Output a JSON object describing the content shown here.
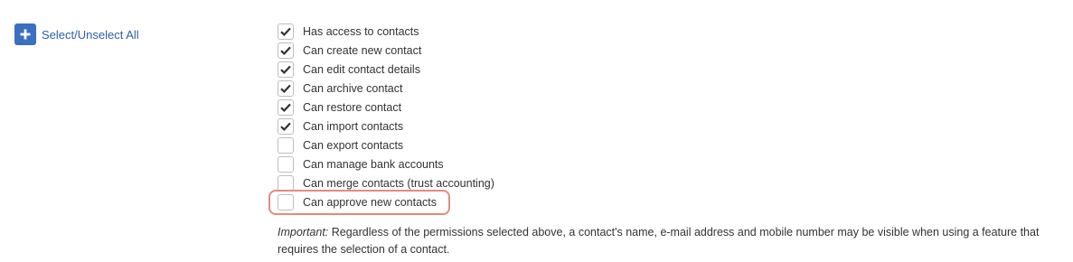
{
  "select_all": {
    "label": "Select/Unselect All",
    "icon": "plus-icon",
    "color": "#3a6fc2"
  },
  "permissions": [
    {
      "label": "Has access to contacts",
      "checked": true
    },
    {
      "label": "Can create new contact",
      "checked": true
    },
    {
      "label": "Can edit contact details",
      "checked": true
    },
    {
      "label": "Can archive contact",
      "checked": true
    },
    {
      "label": "Can restore contact",
      "checked": true
    },
    {
      "label": "Can import contacts",
      "checked": true
    },
    {
      "label": "Can export contacts",
      "checked": false
    },
    {
      "label": "Can manage bank accounts",
      "checked": false
    },
    {
      "label": "Can merge contacts (trust accounting)",
      "checked": false
    },
    {
      "label": "Can approve new contacts",
      "checked": false
    }
  ],
  "highlight": {
    "item": "Can approve new contacts",
    "color": "#e38b7e"
  },
  "note": {
    "prefix": "Important:",
    "text": " Regardless of the permissions selected above, a contact's name, e-mail address and mobile number may be visible when using a feature that requires the selection of a contact."
  }
}
